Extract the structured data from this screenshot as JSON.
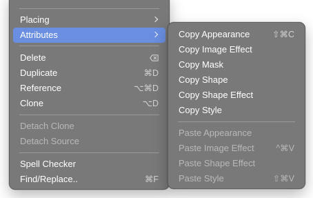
{
  "main_menu": {
    "placing_label": "Placing",
    "attributes_label": "Attributes",
    "delete_label": "Delete",
    "delete_shortcut_icon": "delete-backward-icon",
    "duplicate_label": "Duplicate",
    "duplicate_shortcut": "⌘D",
    "reference_label": "Reference",
    "reference_shortcut": "⌥⌘D",
    "clone_label": "Clone",
    "clone_shortcut": "⌥D",
    "detach_clone_label": "Detach Clone",
    "detach_source_label": "Detach Source",
    "spell_checker_label": "Spell Checker",
    "find_replace_label": "Find/Replace..",
    "find_replace_shortcut": "⌘F"
  },
  "sub_menu": {
    "copy_appearance_label": "Copy Appearance",
    "copy_appearance_shortcut": "⇧⌘C",
    "copy_image_effect_label": "Copy Image Effect",
    "copy_mask_label": "Copy Mask",
    "copy_shape_label": "Copy Shape",
    "copy_shape_effect_label": "Copy Shape Effect",
    "copy_style_label": "Copy Style",
    "paste_appearance_label": "Paste Appearance",
    "paste_image_effect_label": "Paste Image Effect",
    "paste_image_effect_shortcut": "^⌘V",
    "paste_shape_effect_label": "Paste Shape Effect",
    "paste_style_label": "Paste Style",
    "paste_style_shortcut": "⇧⌘V"
  },
  "colors": {
    "menu_background": "#797979",
    "highlight": "#6a8ee0",
    "text": "#ffffff",
    "disabled_text": "#b9b9b9"
  }
}
